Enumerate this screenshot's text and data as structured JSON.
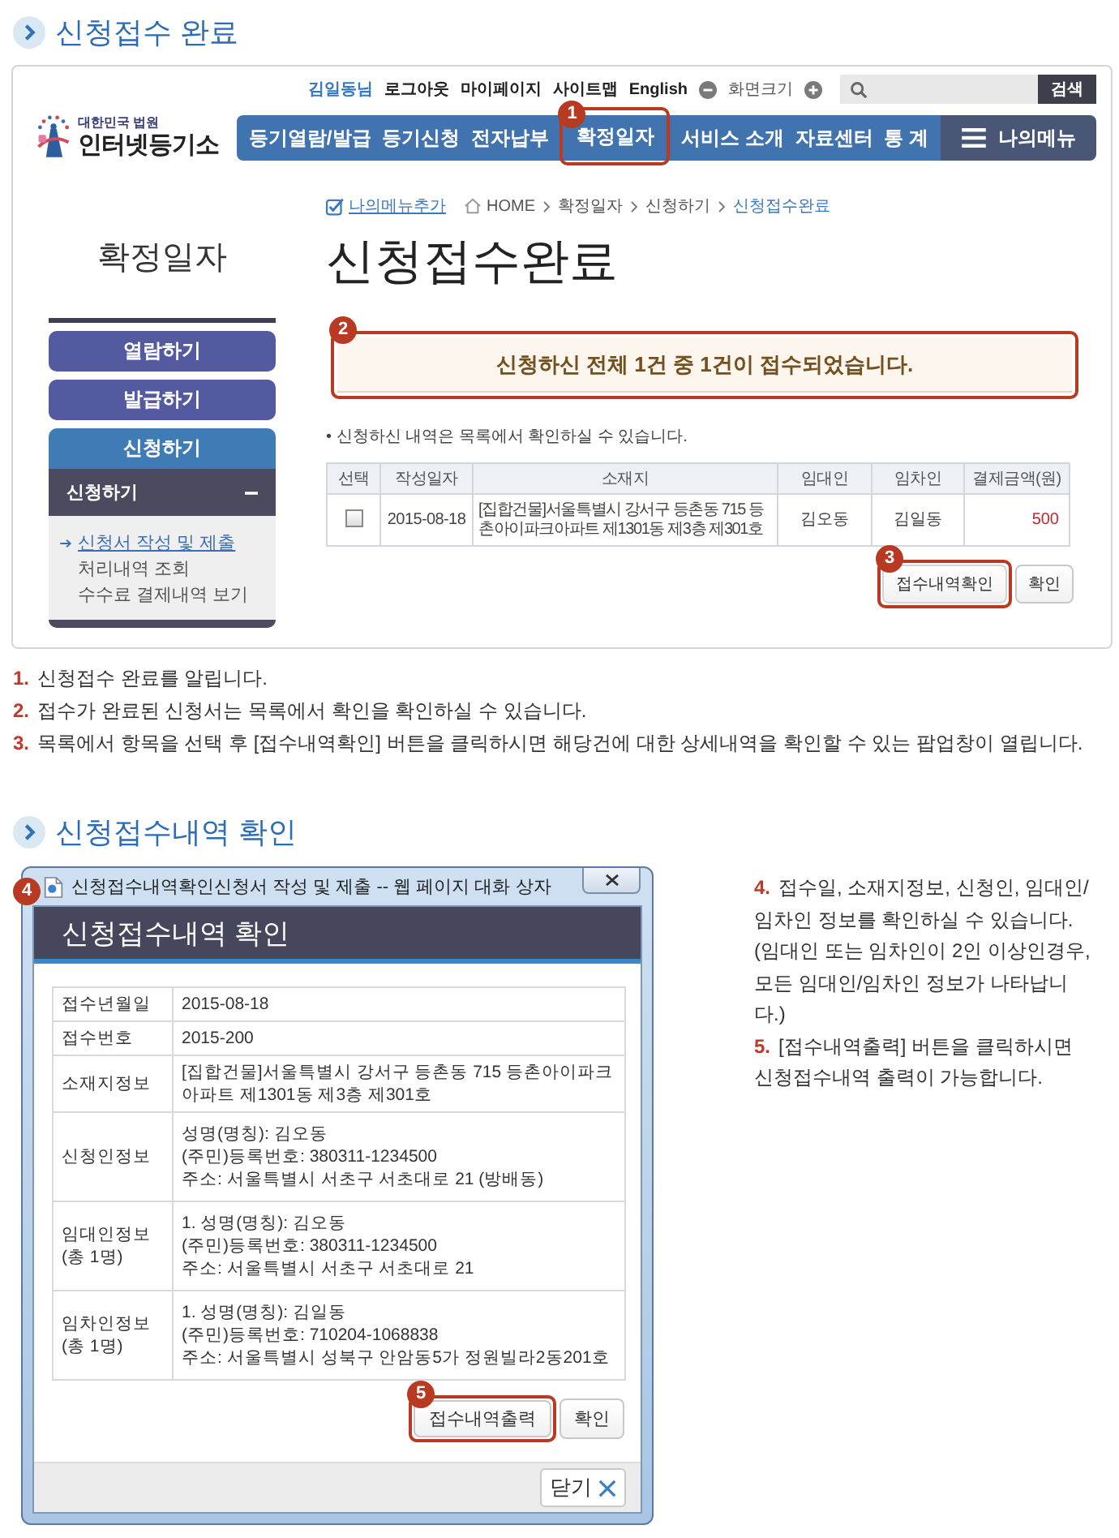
{
  "heading_1": {
    "title": "신청접수 완료"
  },
  "site": {
    "top_bar": {
      "user": "김일동님",
      "links": [
        "로그아웃",
        "마이페이지",
        "사이트맵",
        "English"
      ],
      "zoom_label": "화면크기",
      "search_button": "검색"
    },
    "logo": {
      "org": "대한민국 법원",
      "name": "인터넷등기소"
    },
    "nav": [
      {
        "label": "등기열람/발급"
      },
      {
        "label": "등기신청"
      },
      {
        "label": "전자납부"
      },
      {
        "label": "확정일자",
        "callout": "1"
      },
      {
        "label": "서비스 소개"
      },
      {
        "label": "자료센터"
      },
      {
        "label": "통 계"
      }
    ],
    "my_menu": "나의메뉴",
    "breadcrumb": {
      "add_menu": "나의메뉴추가",
      "items": [
        "HOME",
        "확정일자",
        "신청하기",
        "신청접수완료"
      ]
    },
    "sidebar": {
      "title": "확정일자",
      "buttons": [
        {
          "label": "열람하기",
          "selected": false
        },
        {
          "label": "발급하기",
          "selected": false
        },
        {
          "label": "신청하기",
          "selected": true
        }
      ],
      "submenu": {
        "title": "신청하기",
        "expanded": true,
        "items": [
          {
            "label": "신청서 작성 및 제출",
            "selected": true
          },
          {
            "label": "처리내역 조회",
            "selected": false
          },
          {
            "label": "수수료 결제내역 보기",
            "selected": false
          }
        ]
      }
    },
    "page_title": "신청접수완료",
    "message": {
      "text": "신청하신 전체 1건 중 1건이 접수되었습니다.",
      "callout": "2"
    },
    "note": "• 신청하신 내역은 목록에서 확인하실 수 있습니다.",
    "table": {
      "columns": [
        "선택",
        "작성일자",
        "소재지",
        "임대인",
        "임차인",
        "결제금액(원)"
      ],
      "rows": [
        {
          "checked": false,
          "cells": [
            "",
            "2015-08-18",
            "[집합건물]서울특별시 강서구 등촌동 715 등촌아이파크아파트 제1301동 제3층 제301호",
            "김오동",
            "김일동",
            "500"
          ]
        }
      ]
    },
    "buttons": [
      {
        "label": "접수내역확인",
        "callout": "3"
      },
      {
        "label": "확인"
      }
    ]
  },
  "steps": [
    {
      "number": "1.",
      "text": "신청접수 완료를 알립니다."
    },
    {
      "number": "2.",
      "text": "접수가 완료된 신청서는 목록에서 확인을 확인하실 수 있습니다."
    },
    {
      "number": "3.",
      "text": "목록에서 항목을 선택 후 [접수내역확인] 버튼을 클릭하시면 해당건에 대한 상세내역을 확인할 수 있는 팝업창이 열립니다."
    }
  ],
  "heading_2": {
    "title": "신청접수내역 확인"
  },
  "dialog": {
    "badge": "4",
    "window_title": "신청접수내역확인신청서 작성 및 제출 -- 웹 페이지 대화 상자",
    "header": "신청접수내역 확인",
    "rows": [
      {
        "label": [
          "접수년월일"
        ],
        "value": [
          "2015-08-18"
        ]
      },
      {
        "label": [
          "접수번호"
        ],
        "value": [
          "2015-200"
        ]
      },
      {
        "label": [
          "소재지정보"
        ],
        "value": [
          "[집합건물]서울특별시 강서구 등촌동 715 등촌아이파크아파트 제1301동 제3층 제301호"
        ]
      },
      {
        "label": [
          "신청인정보"
        ],
        "value": [
          "성명(명칭): 김오동",
          "(주민)등록번호: 380311-1234500",
          "주소: 서울특별시 서초구 서초대로 21 (방배동)"
        ]
      },
      {
        "label": [
          "임대인정보",
          "(총 1명)"
        ],
        "value": [
          "1. 성명(명칭): 김오동",
          "(주민)등록번호: 380311-1234500",
          "주소: 서울특별시 서초구 서초대로 21"
        ]
      },
      {
        "label": [
          "임차인정보",
          "(총 1명)"
        ],
        "value": [
          "1. 성명(명칭): 김일동",
          "(주민)등록번호: 710204-1068838",
          "주소: 서울특별시 성북구 안암동5가 정원빌라2동201호"
        ]
      }
    ],
    "buttons": [
      {
        "label": "접수내역출력",
        "callout": "5"
      },
      {
        "label": "확인"
      }
    ],
    "close_button": "닫기"
  },
  "side_notes": [
    {
      "number": "4.",
      "text": "접수일, 소재지정보, 신청인, 임대인/임차인 정보를 확인하실 수 있습니다."
    },
    {
      "text": "(임대인 또는 임차인이 2인 이상인경우, 모든 임대인/임차인 정보가 나타납니다.)"
    },
    {
      "number": "5.",
      "text": "[접수내역출력] 버튼을 클릭하시면 신청접수내역 출력이 가능합니다."
    }
  ]
}
